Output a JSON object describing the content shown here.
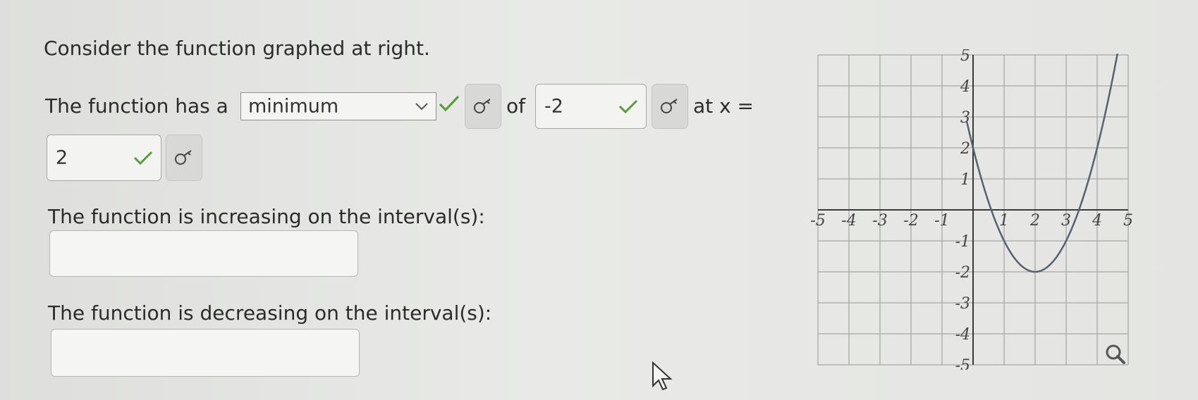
{
  "prompt": "Consider the function graphed at right.",
  "line1": {
    "prefix": "The function has a",
    "extreme_select": "minimum",
    "of_label": "of",
    "value_field": "-2",
    "at_x": "at x ="
  },
  "x_field": "2",
  "increasing": {
    "label": "The function is increasing on the interval(s):",
    "value": ""
  },
  "decreasing": {
    "label": "The function is decreasing on the interval(s):",
    "value": ""
  },
  "colors": {
    "check": "#5a9b3c",
    "curve": "#5a5f6e",
    "grid": "#a7a9a7",
    "axis": "#3a3a3a"
  },
  "chart_data": {
    "type": "line",
    "function": "y = (x - 2)^2 - 2",
    "xlim": [
      -5,
      5
    ],
    "ylim": [
      -5,
      5
    ],
    "x_ticks": [
      "-5",
      "-4",
      "-3",
      "-2",
      "-1",
      "1",
      "2",
      "3",
      "4",
      "5"
    ],
    "y_ticks": [
      "5",
      "4",
      "3",
      "2",
      "1",
      "-1",
      "-2",
      "-3",
      "-4",
      "-5"
    ],
    "vertex": [
      2,
      -2
    ],
    "grid": true,
    "series": [
      {
        "x": [
          -0.2,
          0,
          0.5,
          1,
          1.5,
          2,
          2.5,
          3,
          3.5,
          4,
          4.5,
          5
        ],
        "y": [
          2.84,
          2,
          0.25,
          -1,
          -1.75,
          -2,
          -1.75,
          -1,
          0.25,
          2,
          4.25,
          7
        ]
      }
    ]
  }
}
